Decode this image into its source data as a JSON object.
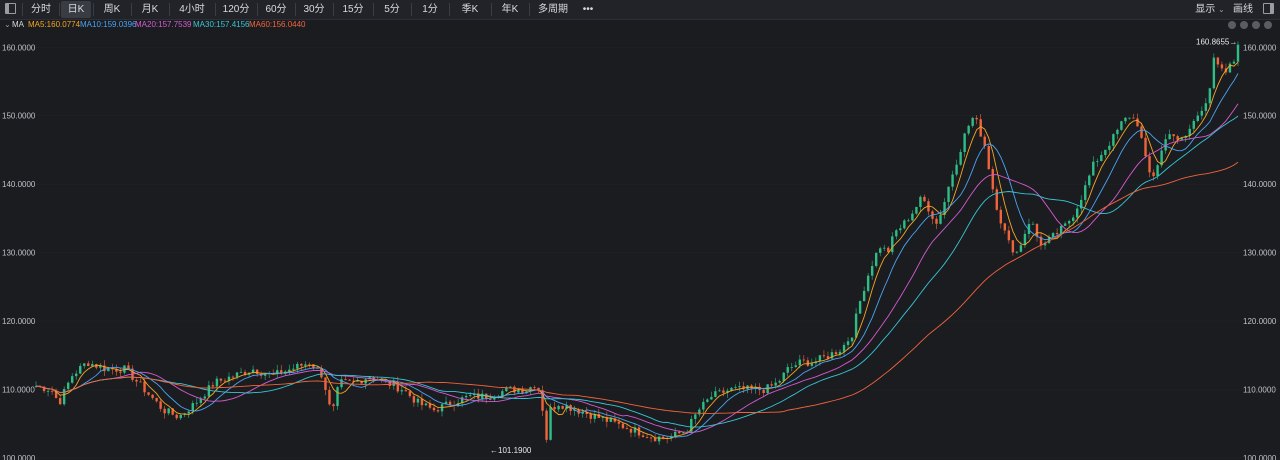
{
  "toolbar": {
    "tabs": [
      "分时",
      "日K",
      "周K",
      "月K",
      "4小时",
      "120分",
      "60分",
      "30分",
      "15分",
      "5分",
      "1分",
      "季K",
      "年K",
      "多周期"
    ],
    "active": "日K",
    "more": "•••",
    "display": "显示",
    "draw": "画线"
  },
  "indicator": {
    "name": "MA",
    "items": [
      {
        "label": "MA5:160.0774",
        "color": "#f5a623"
      },
      {
        "label": "MA10:159.0396",
        "color": "#4aa3f2"
      },
      {
        "label": "MA20:157.7539",
        "color": "#d65bd0"
      },
      {
        "label": "MA30:157.4156",
        "color": "#36c6d6"
      },
      {
        "label": "MA60:156.0440",
        "color": "#f0643c"
      }
    ]
  },
  "chart_data": {
    "type": "candlestick",
    "ylim": [
      100,
      161.5
    ],
    "y_ticks": [
      "160.0000",
      "150.0000",
      "140.0000",
      "130.0000",
      "120.0000",
      "110.0000",
      "100.0000"
    ],
    "y_tick_values": [
      160,
      150,
      140,
      130,
      120,
      110,
      100
    ],
    "close_path": [
      [
        0,
        110.5
      ],
      [
        12,
        110
      ],
      [
        18,
        108
      ],
      [
        28,
        112
      ],
      [
        40,
        114
      ],
      [
        55,
        113
      ],
      [
        70,
        113
      ],
      [
        85,
        110
      ],
      [
        100,
        107
      ],
      [
        112,
        106
      ],
      [
        125,
        108
      ],
      [
        140,
        111
      ],
      [
        155,
        112
      ],
      [
        170,
        113
      ],
      [
        185,
        112
      ],
      [
        200,
        113
      ],
      [
        215,
        114
      ],
      [
        225,
        112
      ],
      [
        232,
        106
      ],
      [
        238,
        111
      ],
      [
        250,
        111
      ],
      [
        262,
        112
      ],
      [
        275,
        111
      ],
      [
        288,
        110
      ],
      [
        300,
        108
      ],
      [
        312,
        107
      ],
      [
        325,
        108
      ],
      [
        340,
        109
      ],
      [
        355,
        109
      ],
      [
        370,
        110
      ],
      [
        385,
        110
      ],
      [
        393,
        111
      ],
      [
        397,
        108
      ],
      [
        400,
        102
      ],
      [
        403,
        107
      ],
      [
        410,
        108
      ],
      [
        425,
        107
      ],
      [
        440,
        106
      ],
      [
        455,
        105
      ],
      [
        470,
        104
      ],
      [
        485,
        103
      ],
      [
        497,
        103
      ],
      [
        510,
        104
      ],
      [
        520,
        107
      ],
      [
        530,
        109
      ],
      [
        545,
        110
      ],
      [
        560,
        110
      ],
      [
        572,
        110
      ],
      [
        582,
        111
      ],
      [
        590,
        113
      ],
      [
        600,
        114
      ],
      [
        610,
        114
      ],
      [
        622,
        115
      ],
      [
        632,
        116
      ],
      [
        640,
        118
      ],
      [
        648,
        124
      ],
      [
        655,
        128
      ],
      [
        662,
        131
      ],
      [
        668,
        130
      ],
      [
        674,
        133
      ],
      [
        680,
        134
      ],
      [
        688,
        136
      ],
      [
        695,
        138
      ],
      [
        702,
        136
      ],
      [
        706,
        134
      ],
      [
        712,
        137
      ],
      [
        718,
        141
      ],
      [
        725,
        145
      ],
      [
        730,
        148
      ],
      [
        736,
        150
      ],
      [
        740,
        148
      ],
      [
        744,
        146
      ],
      [
        748,
        142
      ],
      [
        752,
        138
      ],
      [
        758,
        134
      ],
      [
        764,
        131
      ],
      [
        770,
        130
      ],
      [
        776,
        133
      ],
      [
        780,
        135
      ],
      [
        786,
        132
      ],
      [
        790,
        131
      ],
      [
        796,
        132
      ],
      [
        802,
        133
      ],
      [
        808,
        134
      ],
      [
        815,
        136
      ],
      [
        822,
        139
      ],
      [
        830,
        143
      ],
      [
        838,
        145
      ],
      [
        846,
        147
      ],
      [
        852,
        149
      ],
      [
        858,
        150
      ],
      [
        864,
        149
      ],
      [
        868,
        146
      ],
      [
        872,
        142
      ],
      [
        876,
        141
      ],
      [
        880,
        143
      ],
      [
        885,
        146
      ],
      [
        890,
        148
      ],
      [
        896,
        146
      ],
      [
        902,
        147
      ],
      [
        908,
        149
      ],
      [
        914,
        151
      ],
      [
        920,
        153
      ],
      [
        924,
        158
      ],
      [
        928,
        157
      ],
      [
        932,
        156
      ],
      [
        936,
        157
      ],
      [
        940,
        158
      ],
      [
        943,
        160.8655
      ]
    ],
    "annotations": [
      {
        "label": "160.8655→",
        "value": 160.8655
      },
      {
        "label": "←101.1900",
        "value": 101.19
      }
    ]
  }
}
